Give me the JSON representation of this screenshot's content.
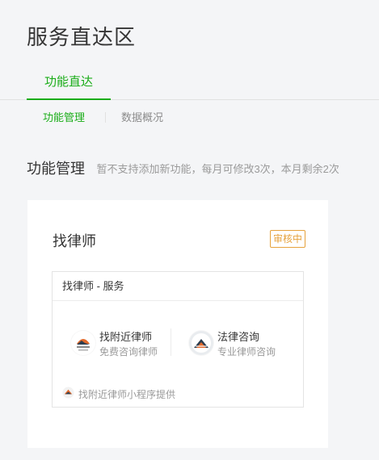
{
  "page": {
    "title": "服务直达区"
  },
  "main_tabs": [
    {
      "label": "功能直达",
      "active": true
    }
  ],
  "sub_tabs": [
    {
      "label": "功能管理",
      "active": true
    },
    {
      "label": "数据概况",
      "active": false
    }
  ],
  "section": {
    "title": "功能管理",
    "note": "暂不支持添加新功能，每月可修改3次，本月剩余2次"
  },
  "card": {
    "title": "找律师",
    "status": "审核中",
    "status_color": "#e6a23c",
    "inner": {
      "header": "找律师 - 服务",
      "services": [
        {
          "name": "找附近律师",
          "desc": "免费咨询律师",
          "icon": "lawyer-logo-icon"
        },
        {
          "name": "法律咨询",
          "desc": "专业律师咨询",
          "icon": "mountain-logo-icon"
        }
      ],
      "provider": {
        "text": "找附近律师小程序提供",
        "icon": "provider-logo-icon"
      }
    }
  },
  "colors": {
    "accent": "#1aad19",
    "muted": "#9a9a9a",
    "text": "#353535"
  }
}
